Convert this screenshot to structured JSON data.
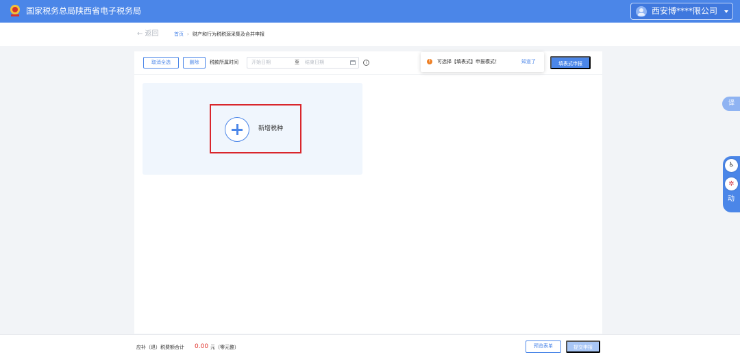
{
  "header": {
    "app_title": "国家税务总局陕西省电子税务局",
    "user_name": "西安博****限公司"
  },
  "breadcrumb": {
    "back_label": "← 返回",
    "home": "首页",
    "separator": "›",
    "current": "财产和行为税税源采集及合并申报"
  },
  "toolbar": {
    "cancel_select_all": "取消全选",
    "delete": "删除",
    "period_label": "税款所属时间",
    "start_date_placeholder": "开始日期",
    "range_separator": "至",
    "end_date_placeholder": "结束日期",
    "info_icon": "i",
    "fill_form_button": "填表式申报"
  },
  "toast": {
    "icon": "!",
    "message": "可选择【填表式】申报模式！",
    "dismiss": "知道了"
  },
  "add_card": {
    "label": "新增税种"
  },
  "floating": {
    "translate": "译",
    "accessibility_icon": "♿",
    "ai_icon": "✲",
    "interact_label": "动"
  },
  "footer": {
    "total_label": "应补（退）税费额合计",
    "amount": "0.00",
    "unit_text": "元（零元整）",
    "preview_button": "预览表单",
    "submit_button": "提交申报"
  },
  "colors": {
    "brand": "#4b86e8",
    "highlight": "#d9262c",
    "warning": "#ee7f24",
    "amount": "#e0322b"
  },
  "icons": [
    "emblem-icon",
    "user-avatar-icon",
    "chevron-down-icon",
    "calendar-icon",
    "info-icon",
    "warning-icon",
    "plus-icon",
    "translate-icon",
    "accessibility-icon",
    "ai-assistant-icon"
  ]
}
